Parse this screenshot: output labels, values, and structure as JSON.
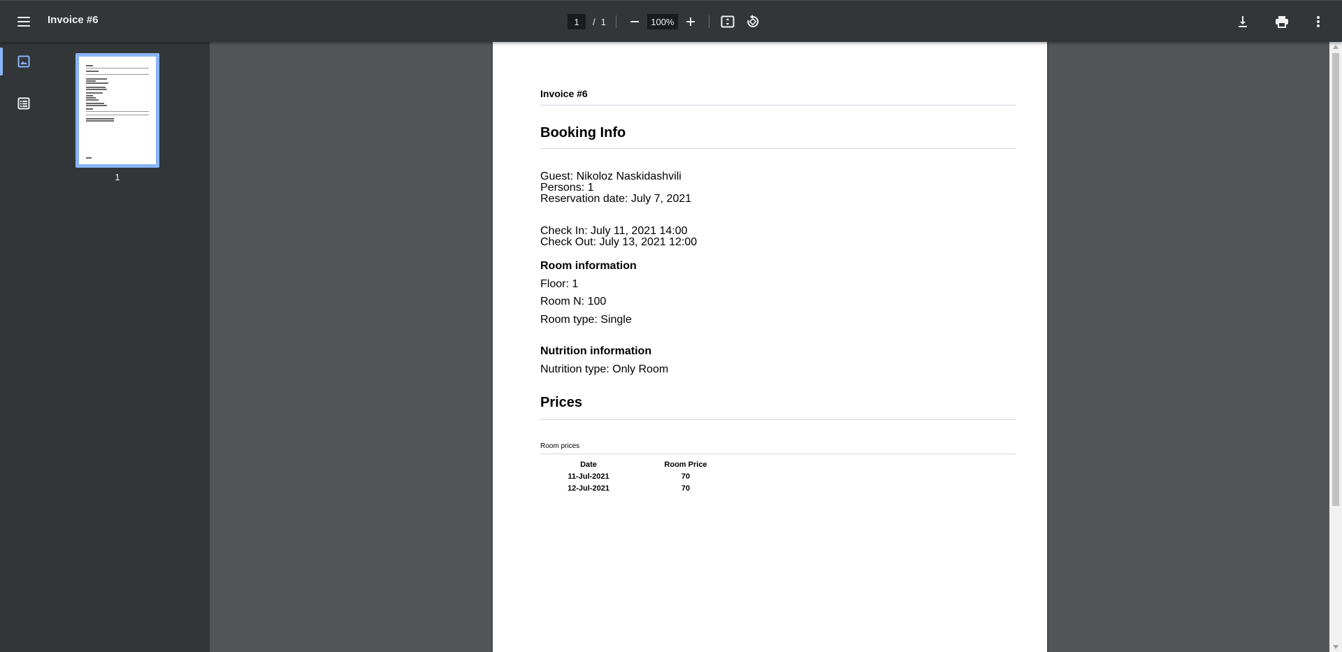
{
  "toolbar": {
    "title": "Invoice #6",
    "page_current": "1",
    "page_separator": "/",
    "page_total": "1",
    "zoom": "100%",
    "icons": [
      "menu-icon",
      "zoom-out-icon",
      "zoom-in-icon",
      "fit-page-icon",
      "rotate-icon",
      "download-icon",
      "print-icon",
      "more-vert-icon"
    ]
  },
  "sidebar": {
    "views": [
      "thumbnails",
      "outline"
    ],
    "thumbnail_label": "1",
    "accent": "#8ab4f8"
  },
  "document": {
    "title": "Invoice #6",
    "booking_heading": "Booking Info",
    "guest": "Guest: Nikoloz Naskidashvili",
    "persons": "Persons: 1",
    "reservation_date": "Reservation date: July 7, 2021",
    "check_in": "Check In: July 11, 2021 14:00",
    "check_out": "Check Out: July 13, 2021 12:00",
    "room_heading": "Room information",
    "floor": "Floor: 1",
    "room_number": "Room N: 100",
    "room_type": "Room type: Single",
    "nutrition_heading": "Nutrition information",
    "nutrition_type": "Nutrition type: Only Room",
    "prices_heading": "Prices",
    "room_prices_label": "Room prices",
    "table": {
      "headers": [
        "Date",
        "Room Price"
      ],
      "rows": [
        [
          "11-Jul-2021",
          "70"
        ],
        [
          "12-Jul-2021",
          "70"
        ]
      ]
    }
  },
  "colors": {
    "toolbar_bg": "#323639",
    "viewer_bg": "#525659",
    "accent": "#8ab4f8"
  }
}
